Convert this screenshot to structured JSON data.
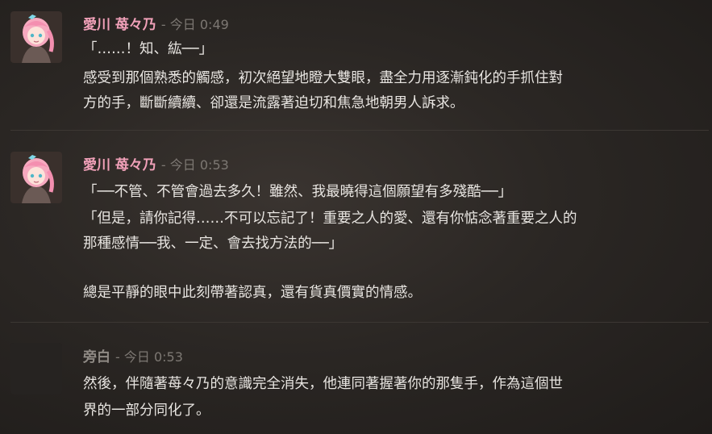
{
  "colors": {
    "character_name": "#f0a0b8",
    "narrator_name": "#8f8a85",
    "timestamp": "#7d7873",
    "text": "#e8e5e1"
  },
  "messages": [
    {
      "author": "愛川 苺々乃",
      "timestamp": "今日 0:49",
      "avatar_icon": "pink-hair-girl-avatar",
      "lines": [
        "「……！知、紘──」",
        "感受到那個熟悉的觸感，初次絕望地瞪大雙眼，盡全力用逐漸鈍化的手抓住對",
        "方的手，斷斷續續、卻還是流露著迫切和焦急地朝男人訴求。"
      ]
    },
    {
      "author": "愛川 苺々乃",
      "timestamp": "今日 0:53",
      "avatar_icon": "pink-hair-girl-avatar",
      "lines": [
        "「──不管、不管會過去多久！雖然、我最曉得這個願望有多殘酷──」",
        "「但是，請你記得……不可以忘記了！重要之人的愛、還有你惦念著重要之人的",
        "那種感情──我、一定、會去找方法的──」",
        "總是平靜的眼中此刻帶著認真，還有貨真價實的情感。"
      ]
    },
    {
      "author": "旁白",
      "timestamp": "今日 0:53",
      "avatar_icon": "narrator-avatar",
      "lines": [
        "然後，伴隨著苺々乃的意識完全消失，他連同著握著你的那隻手，作為這個世",
        "界的一部分同化了。"
      ]
    }
  ]
}
